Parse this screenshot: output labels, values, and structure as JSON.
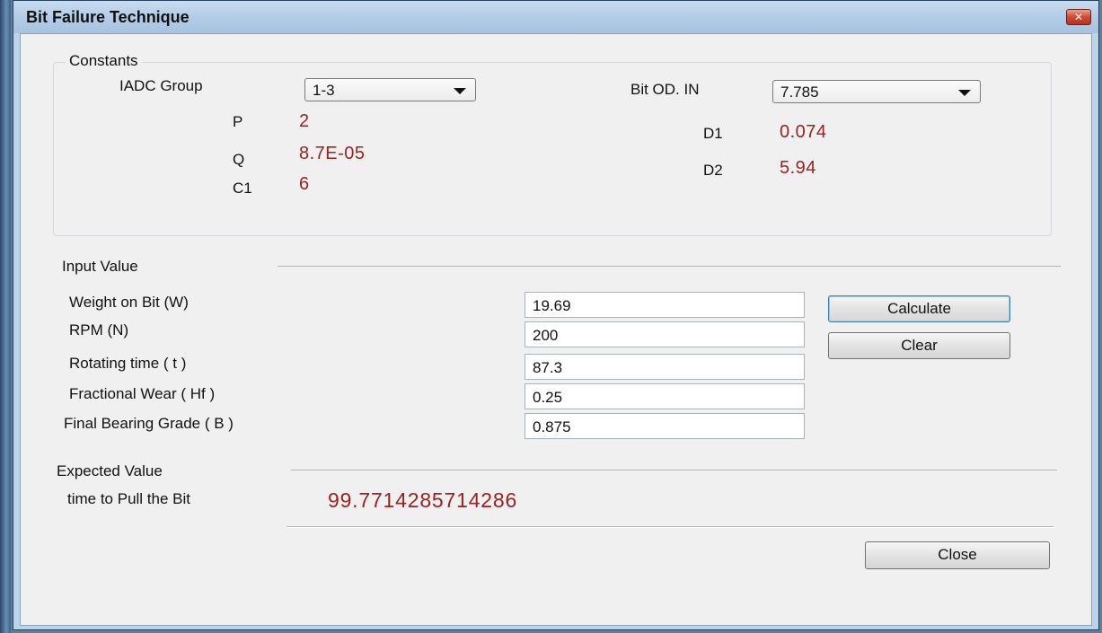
{
  "window": {
    "title": "Bit Failure Technique",
    "close_glyph": "✕"
  },
  "constants": {
    "legend": "Constants",
    "iadc_group": {
      "label": "IADC Group",
      "selected": "1-3"
    },
    "bit_od": {
      "label": "Bit OD. IN",
      "selected": "7.785"
    },
    "p": {
      "label": "P",
      "value": "2"
    },
    "q": {
      "label": "Q",
      "value": "8.7E-05"
    },
    "c1": {
      "label": "C1",
      "value": "6"
    },
    "d1": {
      "label": "D1",
      "value": "0.074"
    },
    "d2": {
      "label": "D2",
      "value": "5.94"
    }
  },
  "input": {
    "heading": "Input Value",
    "fields": [
      {
        "label": "Weight on Bit (W)",
        "value": "19.69"
      },
      {
        "label": "RPM (N)",
        "value": "200"
      },
      {
        "label": "Rotating time ( t )",
        "value": "87.3"
      },
      {
        "label": "Fractional Wear ( Hf )",
        "value": "0.25"
      },
      {
        "label": "Final Bearing Grade ( B )",
        "value": "0.875"
      }
    ],
    "calculate_label": "Calculate",
    "clear_label": "Clear"
  },
  "expected": {
    "heading": "Expected Value",
    "label": "time to Pull the Bit",
    "value": "99.7714285714286"
  },
  "close_label": "Close",
  "icons": {
    "dropdown": "chevron-down-icon",
    "close": "close-icon"
  }
}
